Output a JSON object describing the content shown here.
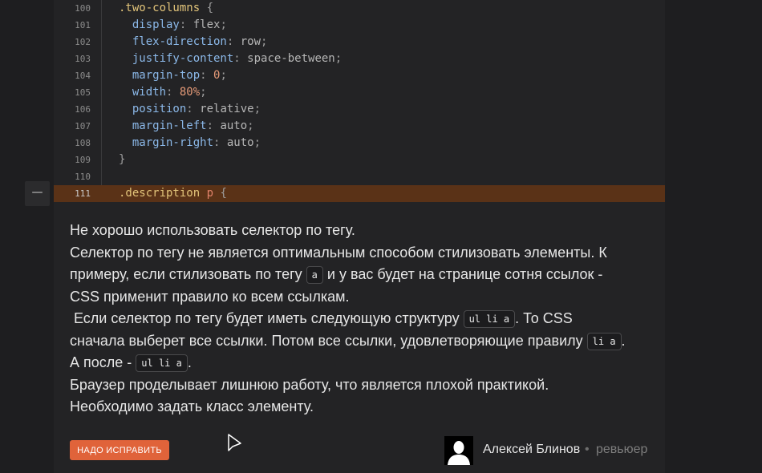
{
  "code": {
    "lines": [
      {
        "num": "100",
        "segments": [
          {
            "t": ".two-columns",
            "c": "sel"
          },
          {
            "t": " {",
            "c": "punc"
          }
        ]
      },
      {
        "num": "101",
        "segments": [
          {
            "t": "  display",
            "c": "prop"
          },
          {
            "t": ": ",
            "c": "punc"
          },
          {
            "t": "flex",
            "c": "val"
          },
          {
            "t": ";",
            "c": "punc"
          }
        ]
      },
      {
        "num": "102",
        "segments": [
          {
            "t": "  flex-direction",
            "c": "prop"
          },
          {
            "t": ": ",
            "c": "punc"
          },
          {
            "t": "row",
            "c": "val"
          },
          {
            "t": ";",
            "c": "punc"
          }
        ]
      },
      {
        "num": "103",
        "segments": [
          {
            "t": "  justify-content",
            "c": "prop"
          },
          {
            "t": ": ",
            "c": "punc"
          },
          {
            "t": "space-between",
            "c": "val"
          },
          {
            "t": ";",
            "c": "punc"
          }
        ]
      },
      {
        "num": "104",
        "segments": [
          {
            "t": "  margin-top",
            "c": "prop"
          },
          {
            "t": ": ",
            "c": "punc"
          },
          {
            "t": "0",
            "c": "num"
          },
          {
            "t": ";",
            "c": "punc"
          }
        ]
      },
      {
        "num": "105",
        "segments": [
          {
            "t": "  width",
            "c": "prop"
          },
          {
            "t": ": ",
            "c": "punc"
          },
          {
            "t": "80%",
            "c": "num"
          },
          {
            "t": ";",
            "c": "punc"
          }
        ]
      },
      {
        "num": "106",
        "segments": [
          {
            "t": "  position",
            "c": "prop"
          },
          {
            "t": ": ",
            "c": "punc"
          },
          {
            "t": "relative",
            "c": "val"
          },
          {
            "t": ";",
            "c": "punc"
          }
        ]
      },
      {
        "num": "107",
        "segments": [
          {
            "t": "  margin-left",
            "c": "prop"
          },
          {
            "t": ": ",
            "c": "punc"
          },
          {
            "t": "auto",
            "c": "val"
          },
          {
            "t": ";",
            "c": "punc"
          }
        ]
      },
      {
        "num": "108",
        "segments": [
          {
            "t": "  margin-right",
            "c": "prop"
          },
          {
            "t": ": ",
            "c": "punc"
          },
          {
            "t": "auto",
            "c": "val"
          },
          {
            "t": ";",
            "c": "punc"
          }
        ]
      },
      {
        "num": "109",
        "segments": [
          {
            "t": "}",
            "c": "punc"
          }
        ]
      },
      {
        "num": "110",
        "segments": []
      },
      {
        "num": "111",
        "highlight": true,
        "segments": [
          {
            "t": ".description",
            "c": "sel"
          },
          {
            "t": " ",
            "c": "punc"
          },
          {
            "t": "p",
            "c": "tag"
          },
          {
            "t": " {",
            "c": "punc"
          }
        ]
      }
    ],
    "collapse_label": "—"
  },
  "comment": {
    "line1": "Не хорошо использовать селектор по тегу.",
    "line2": "Селектор по тегу не является оптимальным способом стилизовать элементы. К",
    "line3_a": "примеру, если стилизовать по тегу ",
    "line3_chip": "a",
    "line3_b": " и у вас будет на странице сотня ссылок -",
    "line4": "CSS применит правило ко всем ссылкам.",
    "line5_a": " Если селектор по тегу будет иметь следующую структуру ",
    "line5_chip": "ul li a",
    "line5_b": ". То CSS",
    "line6_a": "сначала выберет все ссылки. Потом все ссылки, удовлетворяющие правилу ",
    "line6_chip": "li a",
    "line6_b": ".",
    "line7_a": "А после - ",
    "line7_chip": "ul li a",
    "line7_b": ".",
    "line8": "Браузер проделывает лишнюю работу, что является плохой практикой.",
    "line9": "Необходимо задать класс элементу."
  },
  "footer": {
    "fix_label": "НАДО ИСПРАВИТЬ",
    "reviewer_name": "Алексей Блинов",
    "separator": "•",
    "reviewer_role": "ревьюер"
  },
  "icons": {
    "collapse": "collapse-minus-icon",
    "avatar": "user-avatar-icon",
    "cursor": "mouse-cursor-icon"
  },
  "colors": {
    "highlight": "#5a3217",
    "accent": "#e0633a",
    "selector": "#e2c47a",
    "property": "#8bb8e8",
    "number": "#e59a78"
  }
}
